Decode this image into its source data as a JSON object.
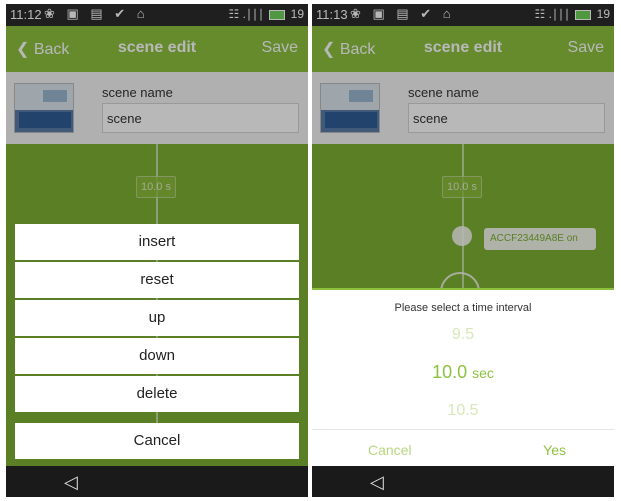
{
  "left_phone": {
    "status": {
      "time": "11:12",
      "icons": "❀ ▣ ▤ ✔ ⌂",
      "signal": "☷ .∣∣∣",
      "battery": "19"
    },
    "header": {
      "back_label": "Back",
      "title": "scene edit",
      "save_label": "Save"
    },
    "scene": {
      "label": "scene name",
      "value": "scene"
    },
    "timeline": {
      "time_badge": "10.0 s"
    },
    "action_sheet": {
      "items": [
        "insert",
        "reset",
        "up",
        "down",
        "delete"
      ],
      "cancel_label": "Cancel"
    },
    "nav": {
      "back_glyph": "◁"
    }
  },
  "right_phone": {
    "status": {
      "time": "11:13",
      "icons": "❀ ▣ ▤ ✔ ⌂",
      "signal": "☷ .∣∣∣",
      "battery": "19"
    },
    "header": {
      "back_label": "Back",
      "title": "scene edit",
      "save_label": "Save"
    },
    "scene": {
      "label": "scene name",
      "value": "scene"
    },
    "timeline": {
      "time_badge": "10.0 s",
      "device_label": "ACCF23449A8E  on"
    },
    "picker": {
      "title": "Please select a time interval",
      "previous": "9.5",
      "current": "10.0",
      "unit": "sec",
      "next": "10.5",
      "cancel_label": "Cancel",
      "yes_label": "Yes"
    },
    "nav": {
      "back_glyph": "◁"
    }
  },
  "colors": {
    "accent": "#8cc13f",
    "background": "#7fb032",
    "statusbar": "#2b2b2b"
  }
}
